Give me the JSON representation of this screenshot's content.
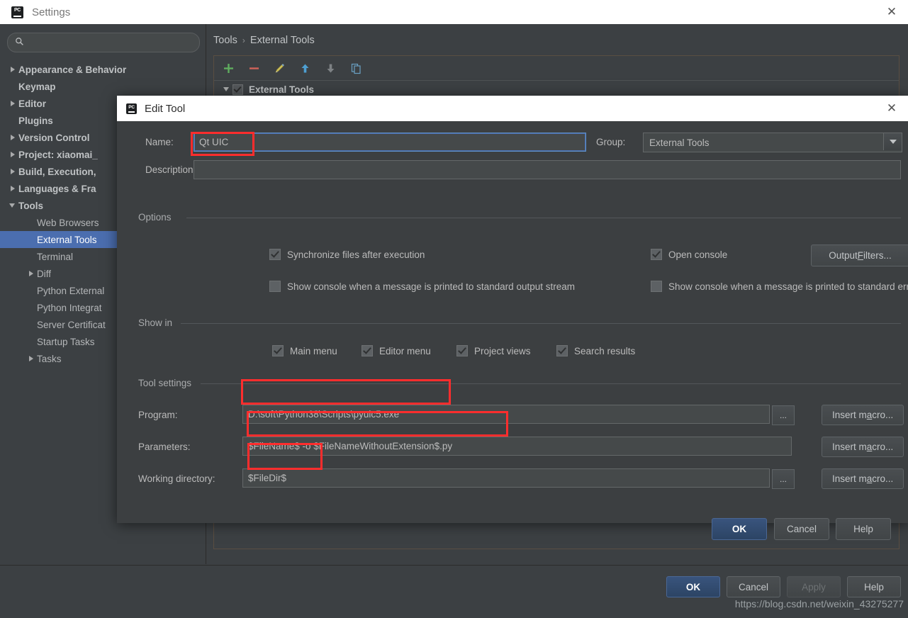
{
  "settings_window": {
    "title": "Settings",
    "icon": "pycharm-icon",
    "close_icon": "close-icon",
    "search": {
      "value": "",
      "placeholder": "",
      "icon": "search-icon"
    },
    "sidebar": {
      "items": [
        {
          "label": "Appearance & Behavior",
          "level": 0,
          "arrow": "closed",
          "selected": false
        },
        {
          "label": "Keymap",
          "level": 0,
          "arrow": "none",
          "selected": false
        },
        {
          "label": "Editor",
          "level": 0,
          "arrow": "closed",
          "selected": false
        },
        {
          "label": "Plugins",
          "level": 0,
          "arrow": "none",
          "selected": false
        },
        {
          "label": "Version Control",
          "level": 0,
          "arrow": "closed",
          "selected": false
        },
        {
          "label": "Project: xiaomai_",
          "level": 0,
          "arrow": "closed",
          "selected": false
        },
        {
          "label": "Build, Execution,",
          "level": 0,
          "arrow": "closed",
          "selected": false
        },
        {
          "label": "Languages & Fra",
          "level": 0,
          "arrow": "closed",
          "selected": false
        },
        {
          "label": "Tools",
          "level": 0,
          "arrow": "open",
          "selected": false
        },
        {
          "label": "Web Browsers",
          "level": 1,
          "arrow": "none",
          "selected": false
        },
        {
          "label": "External Tools",
          "level": 1,
          "arrow": "none",
          "selected": true
        },
        {
          "label": "Terminal",
          "level": 1,
          "arrow": "none",
          "selected": false
        },
        {
          "label": "Diff",
          "level": 1,
          "arrow": "closed",
          "selected": false
        },
        {
          "label": "Python External",
          "level": 1,
          "arrow": "none",
          "selected": false
        },
        {
          "label": "Python Integrat",
          "level": 1,
          "arrow": "none",
          "selected": false
        },
        {
          "label": "Server Certificat",
          "level": 1,
          "arrow": "none",
          "selected": false
        },
        {
          "label": "Startup Tasks",
          "level": 1,
          "arrow": "none",
          "selected": false
        },
        {
          "label": "Tasks",
          "level": 1,
          "arrow": "closed",
          "selected": false
        }
      ]
    },
    "breadcrumb": {
      "parent": "Tools",
      "separator": "›",
      "current": "External Tools"
    },
    "toolbar": {
      "buttons": [
        {
          "name": "add-button",
          "icon": "plus-icon",
          "color": "#5fad5f"
        },
        {
          "name": "remove-button",
          "icon": "minus-icon",
          "color": "#d1635a"
        },
        {
          "name": "edit-button",
          "icon": "pencil-icon",
          "color": "#c9c14e"
        },
        {
          "name": "move-up-button",
          "icon": "arrow-up-icon",
          "color": "#4e9fd1"
        },
        {
          "name": "move-down-button",
          "icon": "arrow-down-icon",
          "color": "#7e8285"
        },
        {
          "name": "copy-button",
          "icon": "copy-icon",
          "color": "#6aa0c4"
        }
      ]
    },
    "tools_list": {
      "group_label": "External Tools",
      "group_checked": true,
      "expanded": true
    },
    "footer": {
      "ok": "OK",
      "cancel": "Cancel",
      "apply": "Apply",
      "apply_disabled": true,
      "help": "Help"
    },
    "watermark": "https://blog.csdn.net/weixin_43275277"
  },
  "edit_tool_dialog": {
    "title": "Edit Tool",
    "icon": "pycharm-icon",
    "close_icon": "close-icon",
    "name": {
      "label": "Name:",
      "value": "Qt UIC",
      "highlighted": true
    },
    "group": {
      "label": "Group:",
      "value": "External Tools",
      "arrow_icon": "chevron-down-icon"
    },
    "description": {
      "label": "Description:",
      "value": ""
    },
    "options": {
      "section_label": "Options",
      "checkboxes": [
        {
          "label": "Synchronize files after execution",
          "checked": true
        },
        {
          "label": "Open console",
          "checked": true
        },
        {
          "label": "Show console when a message is printed to standard output stream",
          "checked": false
        },
        {
          "label": "Show console when a message is printed to standard error stream",
          "checked": false
        }
      ],
      "output_filters_button": {
        "pre": "Output ",
        "mnemonic": "F",
        "post": "ilters..."
      }
    },
    "show_in": {
      "section_label": "Show in",
      "checkboxes": [
        {
          "label": "Main menu",
          "checked": true
        },
        {
          "label": "Editor menu",
          "checked": true
        },
        {
          "label": "Project views",
          "checked": true
        },
        {
          "label": "Search results",
          "checked": true
        }
      ]
    },
    "tool_settings": {
      "section_label": "Tool settings",
      "rows": [
        {
          "label": "Program:",
          "value": "D:\\soft\\Python38\\Scripts\\pyuic5.exe",
          "browse": "...",
          "has_browse": true,
          "highlighted": true
        },
        {
          "label": "Parameters:",
          "value": "$FileName$ -o $FileNameWithoutExtension$.py",
          "browse": "",
          "has_browse": false,
          "highlighted": true
        },
        {
          "label": "Working directory:",
          "value": "$FileDir$",
          "browse": "...",
          "has_browse": true,
          "highlighted": true
        }
      ],
      "insert_macro_button": {
        "pre": "Insert m",
        "mnemonic": "a",
        "post": "cro..."
      }
    },
    "footer": {
      "ok": "OK",
      "cancel": "Cancel",
      "help": "Help"
    }
  },
  "annotation_color": "#ff2d2d"
}
